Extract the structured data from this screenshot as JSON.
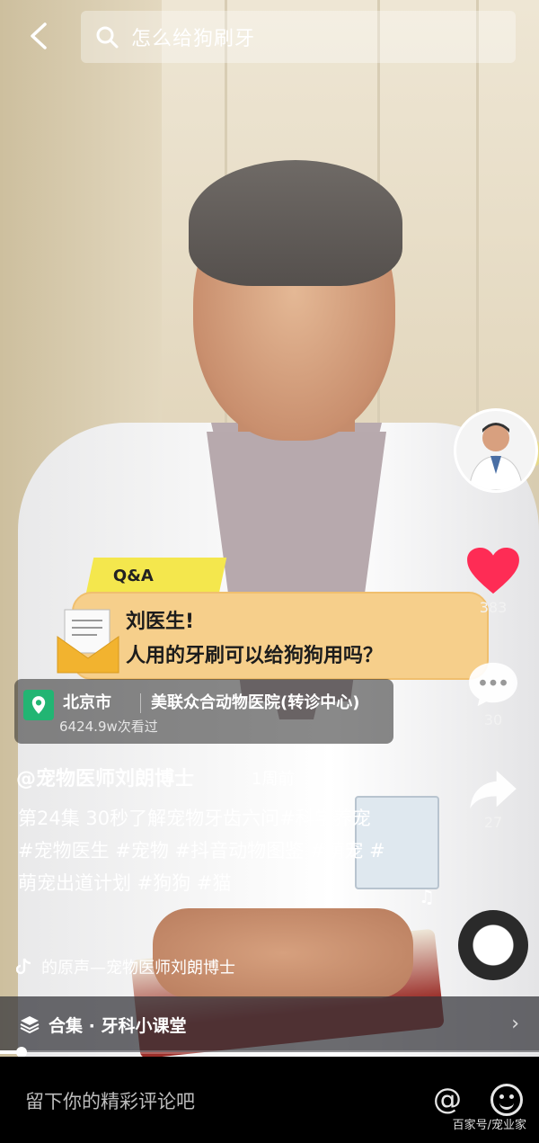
{
  "search": {
    "query": "怎么给狗刷牙"
  },
  "overlay": {
    "tag": "Q&A",
    "line1": "刘医生!",
    "line2": "人用的牙刷可以给狗狗用吗？"
  },
  "right_rail": {
    "likes": "383",
    "comments": "30",
    "shares": "27"
  },
  "location": {
    "city": "北京市",
    "place": "美联众合动物医院(转诊中心)",
    "views": "6424.9w次看过"
  },
  "caption": {
    "author": "@宠物医师刘朗博士",
    "time": "1周前",
    "text": "第24集  30秒了解宠物牙齿六问#科学养宠 #宠物医生 #宠物 #抖音动物图鉴 #萌宠 #萌宠出道计划 #狗狗 #猫"
  },
  "music": {
    "text": "的原声—宠物医师刘朗博士"
  },
  "collection": {
    "label": "合集 · 牙科小课堂"
  },
  "playback": {
    "progress": 0.04
  },
  "comment_bar": {
    "placeholder": "留下你的精彩评论吧"
  },
  "watermark": "百家号/宠业家",
  "colors": {
    "like": "#fe2c55",
    "location_pin": "#22b573",
    "overlay_yellow": "#f6cf8b",
    "qa_yellow": "#f4e74d"
  }
}
